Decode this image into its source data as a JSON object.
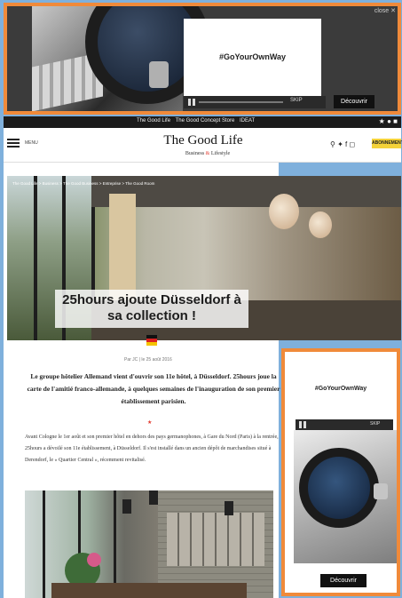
{
  "top_ad": {
    "hashtag": "#GoYourOwnWay",
    "cta": "Découvrir",
    "skip_label": "SKIP",
    "close_label": "close"
  },
  "topbar": {
    "links": [
      "The Good Life",
      "The Good Concept Store",
      "IDEAT"
    ]
  },
  "header": {
    "menu_label": "MENU",
    "logo": "The Good Life",
    "logo_sub_1": "Business",
    "logo_amp": "&",
    "logo_sub_2": "Lifestyle",
    "subscribe": "ABONNEMENT",
    "icons": [
      "search-icon",
      "twitter-icon",
      "facebook-icon",
      "instagram-icon"
    ]
  },
  "hero": {
    "breadcrumb": "The Good Life > Business > The Good Business > Entreprise > The Good Room",
    "headline": "25hours ajoute Düsseldorf à sa collection !",
    "flag_colors": [
      "#111111",
      "#dd2222",
      "#f5c400"
    ]
  },
  "article": {
    "byline": "Par JC | le 25 août 2016",
    "intro": "Le groupe hôtelier Allemand vient d'ouvrir son 11e hôtel, à Düsseldorf. 25hours joue la carte de l'amitié franco-allemande, à quelques semaines de l'inauguration de son premier établissement parisien.",
    "separator": "★",
    "body": "Avant Cologne le 1er août et son premier hôtel en dehors des pays germanophones, à Gare du Nord (Paris) à la rentrée, 25hours a dévoilé son 11e établissement, à Düsseldorf. Il s'est installé dans un ancien dépôt de marchandises situé à Derendorf, le « Quartier Central », récemment revitalisé."
  },
  "side_ad": {
    "hashtag": "#GoYourOwnWay",
    "cta": "Découvrir",
    "skip_label": "SKIP"
  },
  "colors": {
    "ad_border": "#f08a3a",
    "accent_red": "#e23a2f",
    "subscribe_bg": "#f4d23a",
    "page_bg": "#7fb0dc"
  }
}
